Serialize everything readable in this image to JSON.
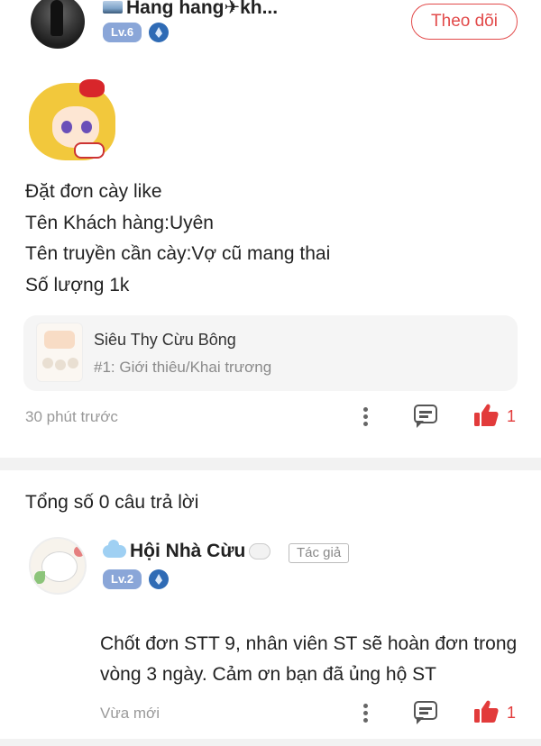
{
  "post": {
    "username": "Hang hang✈kh...",
    "level_badge": "Lv.6",
    "follow_label": "Theo dõi",
    "body_lines": [
      "Đặt đơn cày like",
      "Tên Khách hàng:Uyên",
      "Tên truyền cần cày:Vợ cũ mang thai",
      "Số lượng 1k"
    ],
    "quote_card": {
      "title": "Siêu Thy Cừu Bông",
      "subtitle": "#1: Giới thiêu/Khai trương"
    },
    "time": "30 phút trước",
    "like_count": "1"
  },
  "replies": {
    "count_label": "Tổng số 0 câu trả lời",
    "items": [
      {
        "username": "Hội Nhà Cừu",
        "author_tag": "Tác giả",
        "level_badge": "Lv.2",
        "text": "Chốt đơn STT 9, nhân viên ST sẽ hoàn đơn trong vòng 3 ngày. Cảm ơn bạn đã ủng hộ ST",
        "time": "Vừa mới",
        "like_count": "1"
      }
    ]
  },
  "icons": {
    "more": "more-vertical-icon",
    "comment": "comment-icon",
    "like": "thumbs-up-icon",
    "level_gem": "diamond-icon"
  },
  "colors": {
    "accent": "#e24a4a",
    "level_badge": "#8aa6d8",
    "gem": "#2f6bb5",
    "muted_text": "#999999"
  }
}
